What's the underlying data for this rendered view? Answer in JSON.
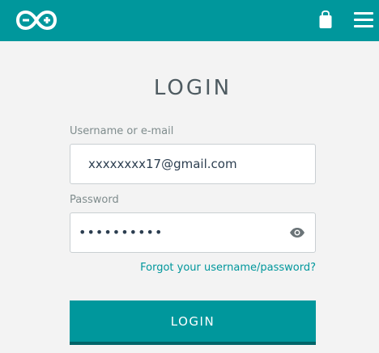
{
  "header": {
    "logo_icon": "infinity-logo-icon",
    "bag_icon": "shopping-bag-icon",
    "menu_icon": "hamburger-menu-icon",
    "color": "#00979c"
  },
  "form": {
    "title": "LOGIN",
    "username_label": "Username or e-mail",
    "username_value": "xxxxxxxx17@gmail.com",
    "password_label": "Password",
    "password_masked": "••••••••••",
    "show_password_icon": "eye-icon",
    "forgot_link": "Forgot your username/password?",
    "login_button": "LOGIN"
  }
}
